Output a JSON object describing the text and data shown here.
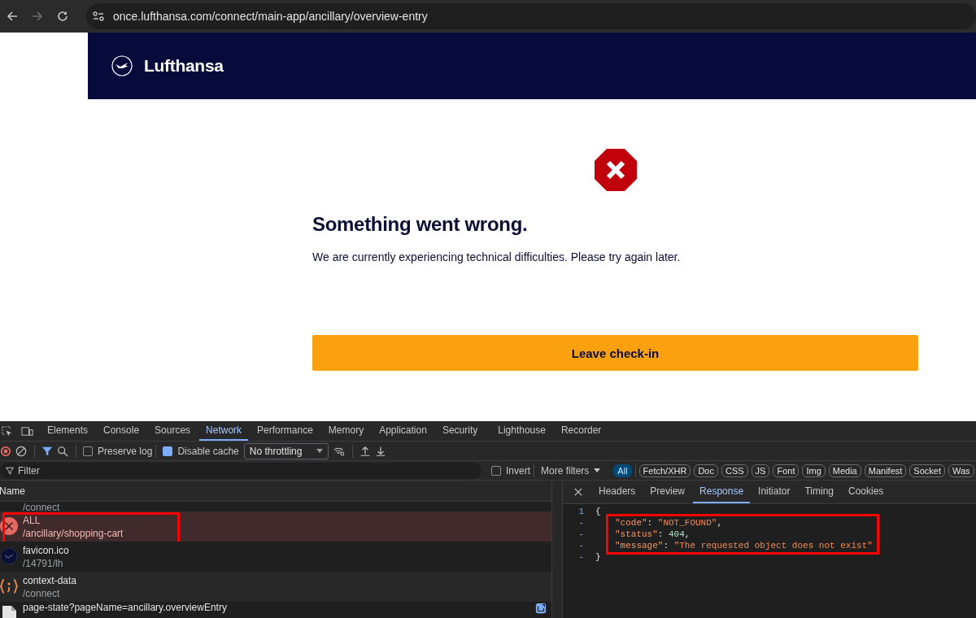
{
  "browser": {
    "url": "once.lufthansa.com/connect/main-app/ancillary/overview-entry"
  },
  "site": {
    "brand": "Lufthansa",
    "heading": "Something went wrong.",
    "message": "We are currently experiencing technical difficulties. Please try again later.",
    "button": "Leave check-in"
  },
  "devtools": {
    "tabs": [
      {
        "label": "Elements",
        "selected": false
      },
      {
        "label": "Console",
        "selected": false
      },
      {
        "label": "Sources",
        "selected": false
      },
      {
        "label": "Network",
        "selected": true
      },
      {
        "label": "Performance",
        "selected": false
      },
      {
        "label": "Memory",
        "selected": false
      },
      {
        "label": "Application",
        "selected": false
      },
      {
        "label": "Security",
        "selected": false
      },
      {
        "label": "Lighthouse",
        "selected": false
      },
      {
        "label": "Recorder",
        "selected": false
      }
    ],
    "toolbar": {
      "preserve_log": {
        "label": "Preserve log",
        "checked": false
      },
      "disable_cache": {
        "label": "Disable cache",
        "checked": true
      },
      "throttling": "No throttling"
    },
    "filter": {
      "placeholder": "Filter",
      "invert": {
        "label": "Invert",
        "checked": false
      },
      "more_filters": "More filters",
      "types": [
        {
          "label": "All",
          "selected": true
        },
        {
          "label": "Fetch/XHR",
          "selected": false
        },
        {
          "label": "Doc",
          "selected": false
        },
        {
          "label": "CSS",
          "selected": false
        },
        {
          "label": "JS",
          "selected": false
        },
        {
          "label": "Font",
          "selected": false
        },
        {
          "label": "Img",
          "selected": false
        },
        {
          "label": "Media",
          "selected": false
        },
        {
          "label": "Manifest",
          "selected": false
        },
        {
          "label": "Socket",
          "selected": false
        },
        {
          "label": "Was",
          "selected": false
        }
      ]
    },
    "requests": {
      "column": "Name",
      "rows": [
        {
          "kind": "partial",
          "path": "/connect",
          "selected": false,
          "highlighted": false
        },
        {
          "kind": "error",
          "name": "ALL",
          "path": "/ancillary/shopping-cart",
          "selected": true,
          "highlighted": true
        },
        {
          "kind": "favicon",
          "name": "favicon.ico",
          "path": "/14791/lh",
          "selected": false,
          "highlighted": false
        },
        {
          "kind": "script",
          "name": "context-data",
          "path": "/connect",
          "selected": false,
          "highlighted": false
        },
        {
          "kind": "document",
          "name": "page-state?pageName=ancillary.overviewEntry",
          "selected": false,
          "highlighted": false
        }
      ]
    },
    "detail": {
      "tabs": [
        {
          "label": "Headers",
          "selected": false
        },
        {
          "label": "Preview",
          "selected": false
        },
        {
          "label": "Response",
          "selected": true
        },
        {
          "label": "Initiator",
          "selected": false
        },
        {
          "label": "Timing",
          "selected": false
        },
        {
          "label": "Cookies",
          "selected": false
        }
      ],
      "lines": [
        {
          "number": "1",
          "highlighted": false,
          "tokens": [
            {
              "kind": "punct",
              "text": "{"
            }
          ]
        },
        {
          "number": "-",
          "highlighted": true,
          "tokens": [
            {
              "kind": "key",
              "text": "\"code\""
            },
            {
              "kind": "punct",
              "text": ": "
            },
            {
              "kind": "string",
              "text": "\"NOT_FOUND\""
            },
            {
              "kind": "punct",
              "text": ","
            }
          ]
        },
        {
          "number": "-",
          "highlighted": true,
          "tokens": [
            {
              "kind": "key",
              "text": "\"status\""
            },
            {
              "kind": "punct",
              "text": ": "
            },
            {
              "kind": "number",
              "text": "404"
            },
            {
              "kind": "punct",
              "text": ","
            }
          ]
        },
        {
          "number": "-",
          "highlighted": true,
          "tokens": [
            {
              "kind": "key",
              "text": "\"message\""
            },
            {
              "kind": "punct",
              "text": ": "
            },
            {
              "kind": "string",
              "text": "\"The requested object does not exist\""
            }
          ]
        },
        {
          "number": "-",
          "highlighted": false,
          "tokens": [
            {
              "kind": "punct",
              "text": "}"
            }
          ]
        }
      ]
    }
  }
}
